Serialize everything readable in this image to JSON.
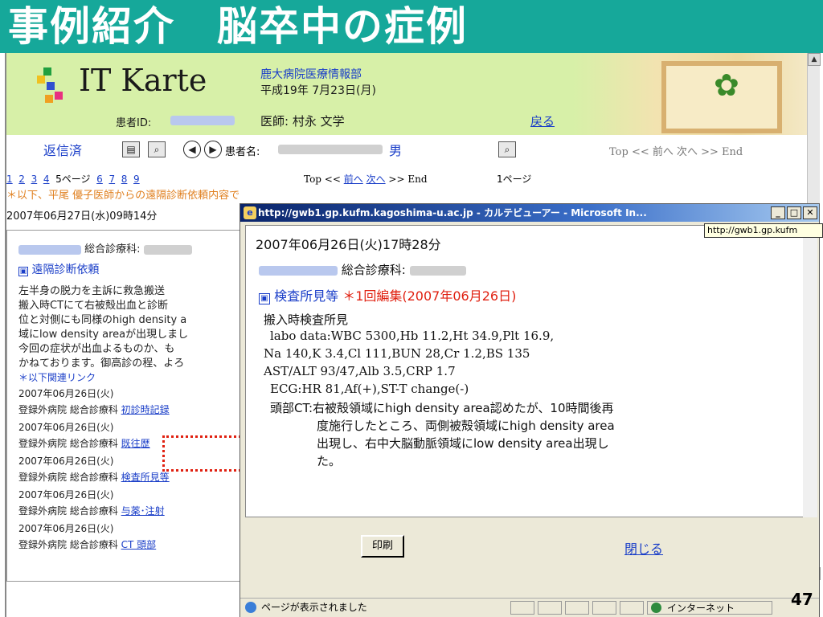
{
  "slide": {
    "title": "事例紹介　脳卒中の症例",
    "page_number": "47"
  },
  "karte": {
    "logo_text": "IT Karte",
    "dept": "鹿大病院医療情報部",
    "date": "平成19年 7月23日(月)",
    "patient_id_label": "患者ID:",
    "doctor": "医師: 村永 文学",
    "back_link": "戻る",
    "reply_label": "返信済",
    "patient_name_label": "患者名:",
    "patient_sex": "男",
    "nav_top_right": "Top << 前へ 次へ >> End",
    "pages_left": [
      "1",
      "2",
      "3",
      "4"
    ],
    "current_page_left": "5ページ",
    "pages_right": [
      "6",
      "7",
      "8",
      "9"
    ],
    "nav_mid": {
      "top": "Top <<",
      "prev": "前へ",
      "next": "次へ",
      "end": ">> End"
    },
    "page_1_label": "1ページ",
    "notice": "＊以下、平尾 優子医師からの遠隔診断依頼内容です",
    "left_datetime": "2007年06月27日(水)09時14分"
  },
  "left_panel": {
    "dept_label": "総合診療科:",
    "section_title": "遠隔診断依頼",
    "body_lines": [
      "左半身の脱力を主訴に救急搬送",
      "搬入時CTにて右被殻出血と診断",
      "位と対側にも同様のhigh density a",
      "域にlow density areaが出現しまし",
      "今回の症状が出血よるものか、も",
      "かねております。御高診の程、よろ"
    ],
    "related_label": "＊以下関連リンク",
    "related": [
      {
        "date": "2007年06月26日(火)",
        "prefix": "登録外病院 総合診療科",
        "link": "初診時記録"
      },
      {
        "date": "2007年06月26日(火)",
        "prefix": "登録外病院 総合診療科",
        "link": "既往歴"
      },
      {
        "date": "2007年06月26日(火)",
        "prefix": "登録外病院 総合診療科",
        "link": "検査所見等"
      },
      {
        "date": "2007年06月26日(火)",
        "prefix": "登録外病院 総合診療科",
        "link": "与薬･注射"
      },
      {
        "date": "2007年06月26日(火)",
        "prefix": "登録外病院 総合診療科",
        "link": "CT 頭部"
      }
    ]
  },
  "popup": {
    "window_title": "http://gwb1.gp.kufm.kagoshima-u.ac.jp - カルテビューアー - Microsoft In...",
    "tooltip": "http://gwb1.gp.kufm",
    "datetime": "2007年06月26日(火)17時28分",
    "dept_label": "総合診療科:",
    "section_title": "検査所見等",
    "edit_note": "＊1回編集(2007年06月26日)",
    "body_lines": [
      "搬入時検査所見",
      "labo data:WBC 5300,Hb 11.2,Ht 34.9,Plt 16.9,",
      "Na 140,K 3.4,Cl 111,BUN 28,Cr 1.2,BS 135",
      "AST/ALT 93/47,Alb 3.5,CRP 1.7",
      "ECG:HR 81,Af(+),ST-T change(-)",
      "頭部CT:右被殻領域にhigh density area認めたが、10時間後再",
      "度施行したところ、両側被殻領域にhigh density area",
      "出現し、右中大脳動脈領域にlow density area出現し",
      "た。"
    ],
    "print_button": "印刷",
    "close_link": "閉じる",
    "status_text": "ページが表示されました",
    "zone_text": "インターネット"
  },
  "colors": {
    "title_bar": "#16a89a",
    "header_bg": "#d7f0a8",
    "link": "#1a3ec8",
    "accent_red": "#e02010"
  }
}
